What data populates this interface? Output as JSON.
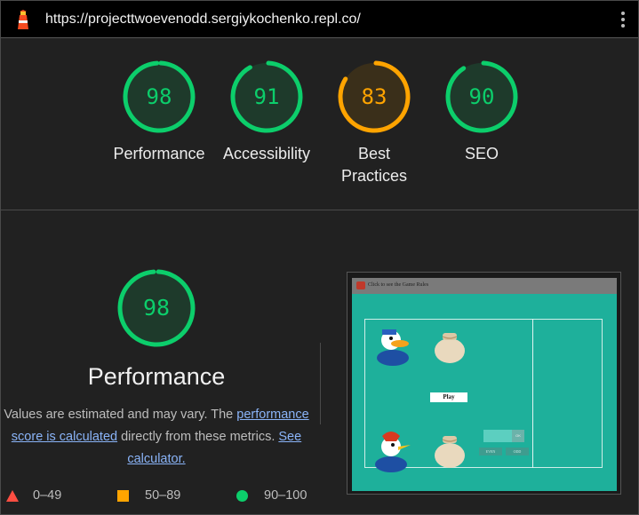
{
  "url_bar": {
    "url": "https://projecttwoevenodd.sergiykochenko.repl.co/",
    "logo_icon": "lighthouse-icon",
    "menu_icon": "kebab-menu-icon"
  },
  "colors": {
    "pass": "#0cce6b",
    "average": "#ffa400",
    "fail": "#ff4e42"
  },
  "categories": [
    {
      "label": "Performance",
      "score": "98",
      "status": "pass"
    },
    {
      "label": "Accessibility",
      "score": "91",
      "status": "pass"
    },
    {
      "label_line1": "Best",
      "label_line2": "Practices",
      "score": "83",
      "status": "average"
    },
    {
      "label": "SEO",
      "score": "90",
      "status": "pass"
    }
  ],
  "performance": {
    "score": "98",
    "title": "Performance",
    "desc_part1": "Values are estimated and may vary. The ",
    "desc_link1": "performance score is calculated",
    "desc_part2": " directly from these metrics. ",
    "desc_link2": "See calculator."
  },
  "legend": [
    {
      "range": "0–49",
      "shape": "triangle",
      "color": "#ff4e42"
    },
    {
      "range": "50–89",
      "shape": "square",
      "color": "#ffa400"
    },
    {
      "range": "90–100",
      "shape": "circle",
      "color": "#0cce6b"
    }
  ],
  "screenshot": {
    "hint_text": "Click to see the Game Rules",
    "play_label": "Play",
    "ok_label": "OK",
    "even_label": "EVEN",
    "odd_label": "ODD"
  }
}
